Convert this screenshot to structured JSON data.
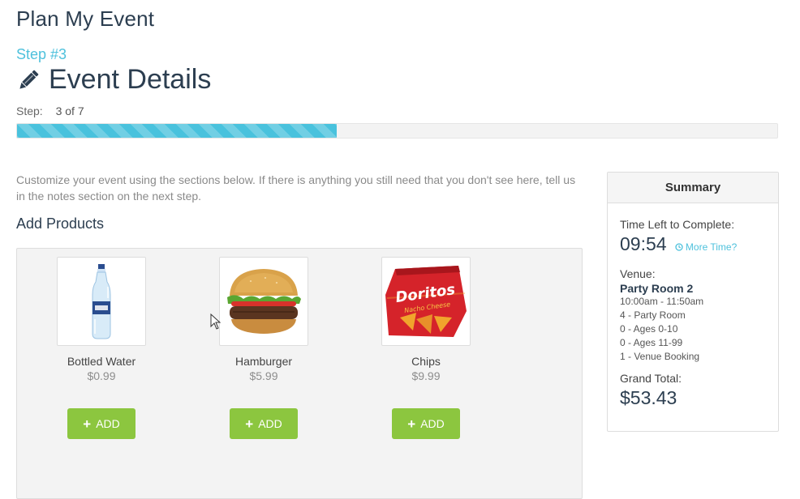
{
  "app_title": "Plan My Event",
  "step_number_label": "Step #3",
  "section": {
    "icon": "pencil-icon",
    "title": "Event Details"
  },
  "progress": {
    "label": "Step:",
    "value_text": "3 of 7",
    "fraction": 0.42,
    "color": "#49c2dd"
  },
  "intro_text": "Customize your event using the sections below. If there is anything you still need that you don't see here, tell us in the notes section on the next step.",
  "add_products": {
    "title": "Add Products",
    "items": [
      {
        "name": "Bottled Water",
        "price": "$0.99",
        "button": "ADD",
        "image": "bottled-water-image"
      },
      {
        "name": "Hamburger",
        "price": "$5.99",
        "button": "ADD",
        "image": "hamburger-image"
      },
      {
        "name": "Chips",
        "price": "$9.99",
        "button": "ADD",
        "image": "chips-bag-image",
        "brand": "Doritos",
        "brand_sub": "Nacho Cheese"
      }
    ]
  },
  "summary": {
    "title": "Summary",
    "time_left_label": "Time Left to Complete:",
    "time_left": "09:54",
    "more_time": "More Time?",
    "venue_label": "Venue:",
    "venue_name": "Party Room 2",
    "venue_lines": [
      "10:00am - 11:50am",
      "4 - Party Room",
      "0 - Ages 0-10",
      "0 - Ages 11-99",
      "1 - Venue Booking"
    ],
    "grand_total_label": "Grand Total:",
    "grand_total": "$53.43"
  },
  "colors": {
    "accent": "#4ec1dc",
    "add_button": "#8cc63f",
    "heading": "#2c3e50"
  }
}
